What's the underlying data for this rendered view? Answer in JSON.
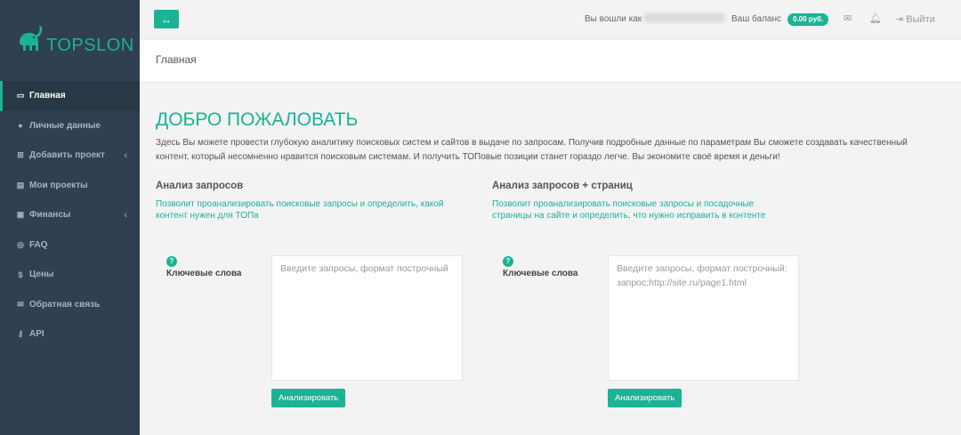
{
  "brand": {
    "name": "TOPSLON",
    "logo_icon": "elephant-icon",
    "accent_color": "#1ab394",
    "sidebar_bg": "#2f4050"
  },
  "sidebar": {
    "items": [
      {
        "label": "Главная",
        "icon": "monitor-icon"
      },
      {
        "label": "Личные данные",
        "icon": "user-icon"
      },
      {
        "label": "Добавить проект",
        "icon": "plus-square-icon"
      },
      {
        "label": "Мои проекты",
        "icon": "list-icon"
      },
      {
        "label": "Финансы",
        "icon": "money-icon"
      },
      {
        "label": "FAQ",
        "icon": "lifebuoy-icon"
      },
      {
        "label": "Цены",
        "icon": "dollar-icon"
      },
      {
        "label": "Обратная связь",
        "icon": "envelope-icon"
      },
      {
        "label": "API",
        "icon": "key-icon"
      }
    ]
  },
  "topbar": {
    "logged_in_label": "Вы вошли как",
    "balance_label": "Ваш баланс",
    "balance_value": "0.00 руб.",
    "logout_label": "Выйти"
  },
  "breadcrumb": "Главная",
  "main": {
    "title": "ДОБРО ПОЖАЛОВАТЬ",
    "intro": "Здесь Вы можете провести глубокую аналитику поисковых систем и сайтов в выдаче по запросам. Получив подробные данные по параметрам Вы сможете создавать качественный контент, который несомненно нравится поисковым системам. И получить ТОПовые позиции станет гораздо легче. Вы экономите своё время и деньги!",
    "left": {
      "heading": "Анализ запросов",
      "description": "Позволит проанализировать поисковые запросы и определить, какой контент нужен для ТОПа",
      "help": "?",
      "field_label": "Ключевые слова",
      "placeholder": "Введите запросы, формат построчный",
      "button": "Анализировать"
    },
    "right": {
      "heading": "Анализ запросов + страниц",
      "description": "Позволит проанализировать поисковые запросы и посадочные страницы на сайте и определить, что нужно исправить в контенте",
      "help": "?",
      "field_label": "Ключевые слова",
      "placeholder": "Введите запросы, формат построчный:\nзапрос;http://site.ru/page1.html",
      "button": "Анализировать"
    }
  }
}
